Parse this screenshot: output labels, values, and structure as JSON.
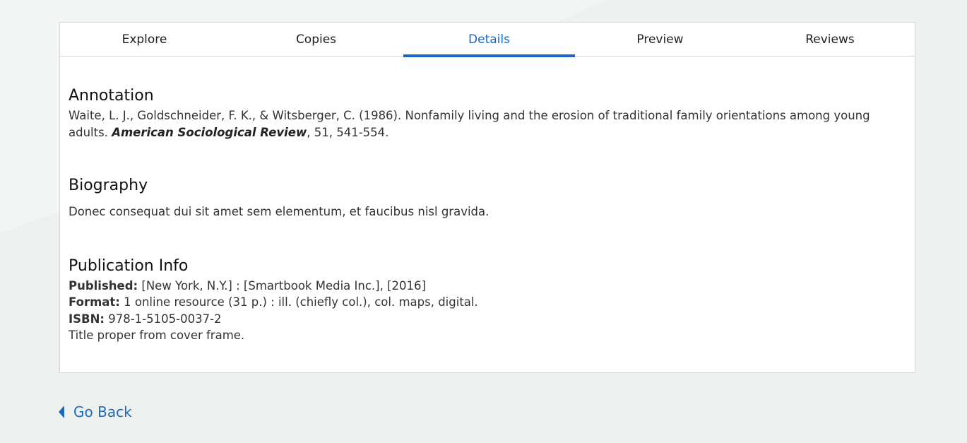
{
  "tabs": [
    {
      "label": "Explore"
    },
    {
      "label": "Copies"
    },
    {
      "label": "Details"
    },
    {
      "label": "Preview"
    },
    {
      "label": "Reviews"
    }
  ],
  "active_tab": "Details",
  "annotation": {
    "heading": "Annotation",
    "text_before": "Waite, L. J., Goldschneider, F. K., & Witsberger, C. (1986). Nonfamily living and the erosion of traditional family orientations among young adults. ",
    "journal": "American Sociological Review",
    "text_after": ", 51, 541-554."
  },
  "biography": {
    "heading": "Biography",
    "text": "Donec consequat dui sit amet sem elementum, et faucibus nisl gravida."
  },
  "publication": {
    "heading": "Publication Info",
    "published_label": "Published:",
    "published_value": " [New York, N.Y.] : [Smartbook Media Inc.], [2016]",
    "format_label": "Format:",
    "format_value": " 1 online resource (31 p.) : ill. (chiefly col.), col. maps, digital.",
    "isbn_label": "ISBN:",
    "isbn_value": " 978-1-5105-0037-2",
    "note": "Title proper from cover frame."
  },
  "go_back": {
    "label": "Go Back",
    "icon": "caret-left-icon"
  },
  "colors": {
    "accent": "#1a66c4",
    "link": "#1a6fb8",
    "background": "#eef0f0"
  }
}
